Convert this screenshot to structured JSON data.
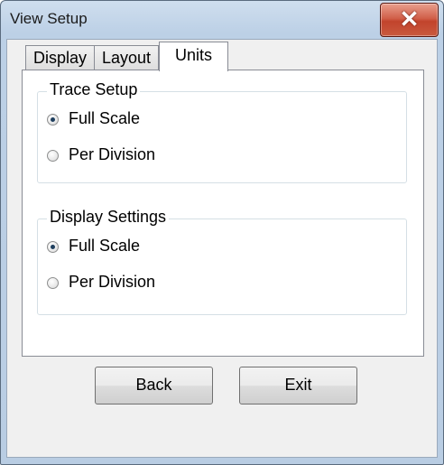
{
  "window": {
    "title": "View Setup",
    "close_glyph": "✕"
  },
  "tabs": [
    {
      "label": "Display",
      "active": false
    },
    {
      "label": "Layout",
      "active": false
    },
    {
      "label": "Units",
      "active": true
    }
  ],
  "trace_setup": {
    "title": "Trace Setup",
    "options": [
      {
        "label": "Full Scale",
        "selected": true
      },
      {
        "label": "Per Division",
        "selected": false
      }
    ]
  },
  "display_settings": {
    "title": "Display Settings",
    "options": [
      {
        "label": "Full Scale",
        "selected": true
      },
      {
        "label": "Per Division",
        "selected": false
      }
    ]
  },
  "buttons": {
    "back": "Back",
    "exit": "Exit"
  },
  "colors": {
    "close_button": "#c95a3f",
    "title_bar": "#bcd0e6",
    "panel_bg": "#ffffff"
  }
}
